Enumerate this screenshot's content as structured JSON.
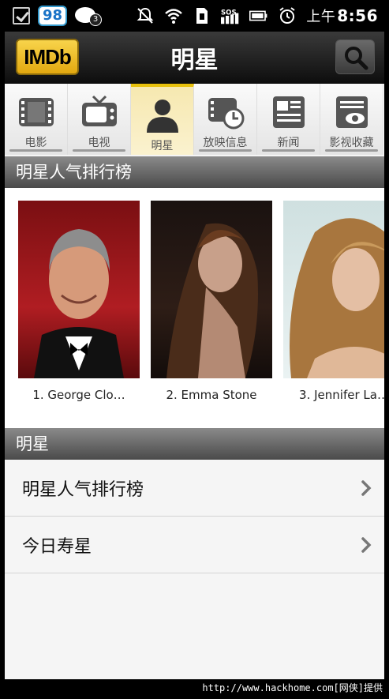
{
  "status_bar": {
    "badge": "98",
    "chat_count": "3",
    "time_prefix": "上午",
    "time": "8:56",
    "icons": [
      "checkbox-icon",
      "alarm-off-icon",
      "wifi-icon",
      "sim-icon",
      "sos-signal-icon",
      "battery-icon",
      "alarm-clock-icon"
    ]
  },
  "app_bar": {
    "logo_text": "IMDb",
    "title": "明星",
    "search_icon": "search-icon"
  },
  "tabs": [
    {
      "label": "电影",
      "icon": "film-icon",
      "active": false
    },
    {
      "label": "电视",
      "icon": "tv-icon",
      "active": false
    },
    {
      "label": "明星",
      "icon": "person-icon",
      "active": true
    },
    {
      "label": "放映信息",
      "icon": "showtimes-icon",
      "active": false
    },
    {
      "label": "新闻",
      "icon": "news-icon",
      "active": false
    },
    {
      "label": "影视收藏",
      "icon": "watchlist-icon",
      "active": false
    }
  ],
  "popular_section": {
    "title": "明星人气排行榜",
    "stars": [
      {
        "name": "1. George Clo…",
        "photo_palette": "george"
      },
      {
        "name": "2. Emma Stone",
        "photo_palette": "emma"
      },
      {
        "name": "3. Jennifer La…",
        "photo_palette": "jennifer"
      }
    ]
  },
  "stars_section": {
    "title": "明星",
    "items": [
      {
        "label": "明星人气排行榜"
      },
      {
        "label": "今日寿星"
      }
    ]
  },
  "footer": {
    "text": "http://www.hackhome.com[网侠]提供"
  },
  "colors": {
    "imdb_yellow": "#e8c10c",
    "active_tab_bg": "#f6e8b0",
    "section_header": "#5a5a5a"
  }
}
